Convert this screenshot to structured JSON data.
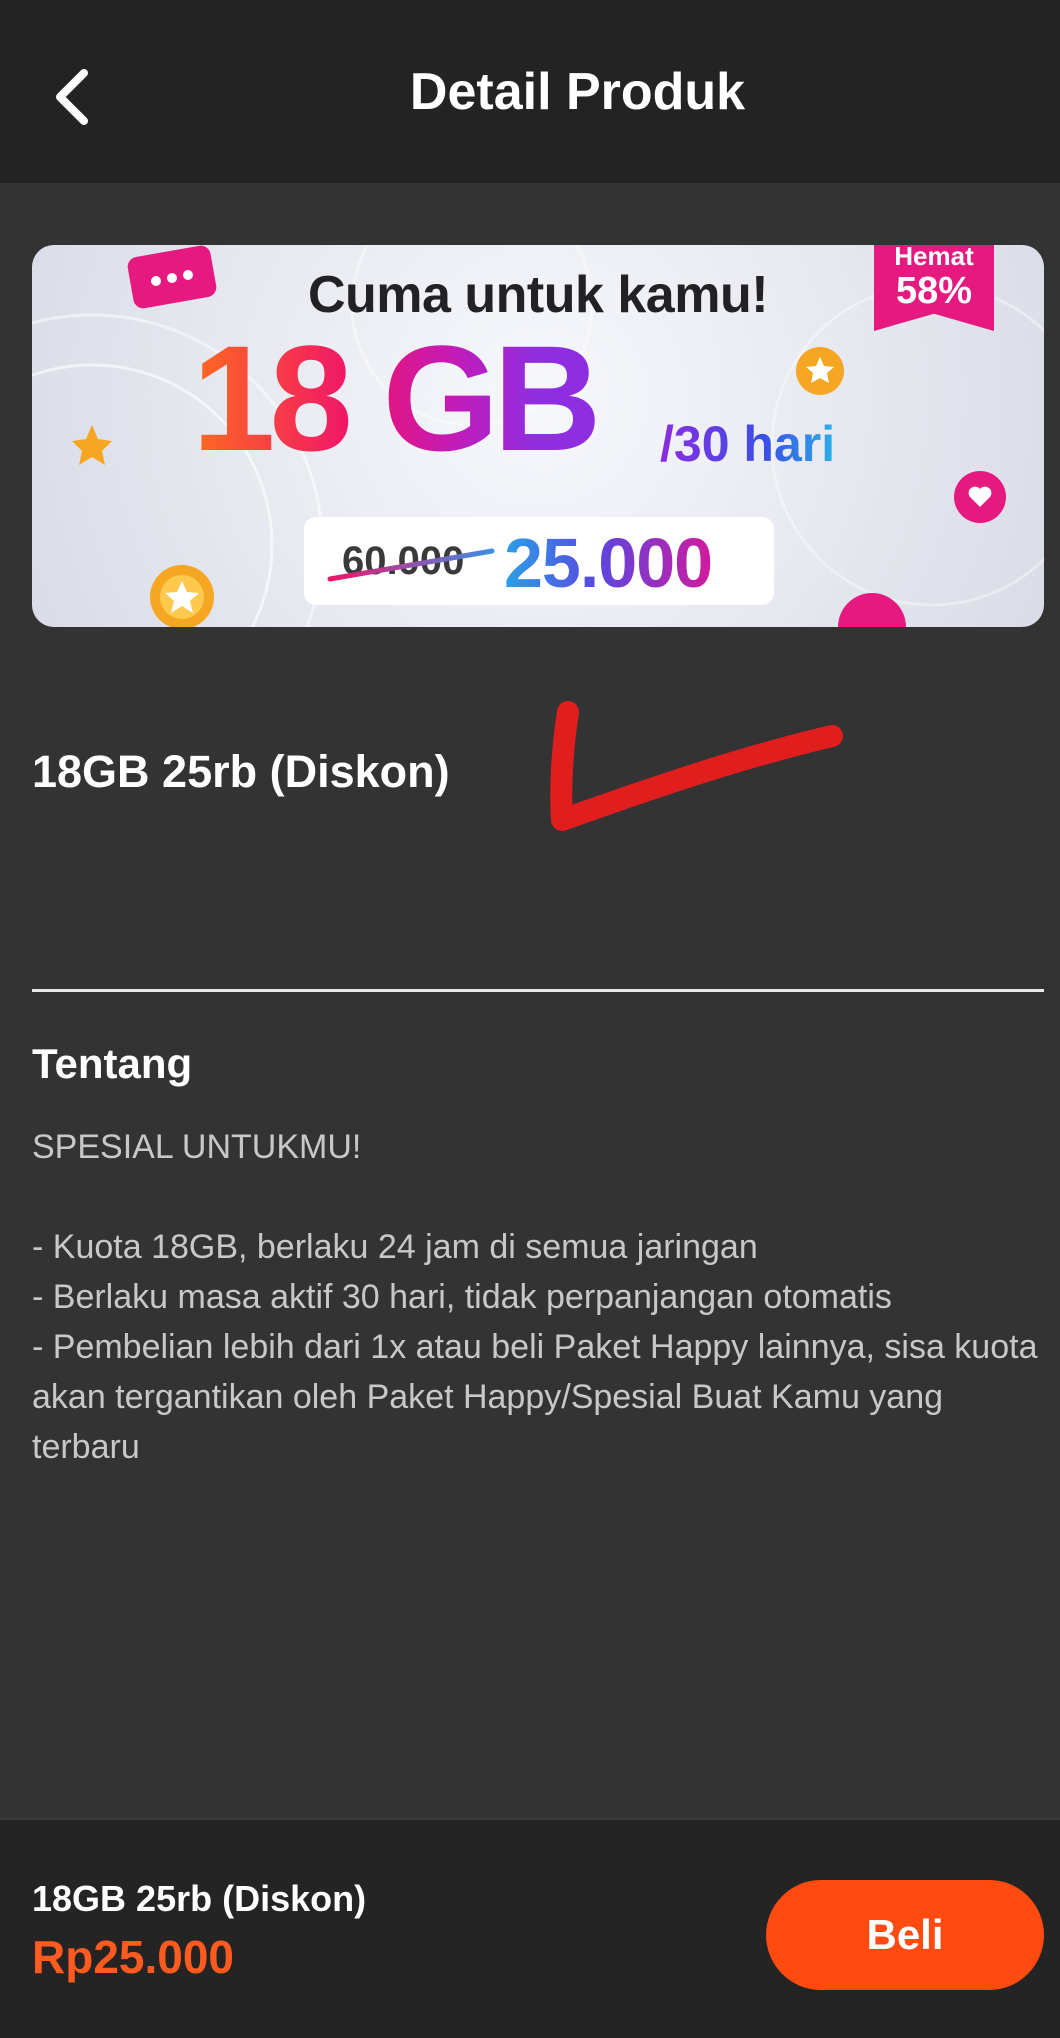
{
  "header": {
    "title": "Detail Produk",
    "back_icon": "chevron-left-icon"
  },
  "banner": {
    "headline": "Cuma untuk kamu!",
    "badge_label": "Hemat",
    "badge_value": "58%",
    "quota": "18 GB",
    "period": "/30 hari",
    "old_price": "60.000",
    "new_price": "25.000"
  },
  "product": {
    "name": "18GB 25rb (Diskon)"
  },
  "about": {
    "title": "Tentang",
    "body": "SPESIAL UNTUKMU!\n\n- Kuota 18GB, berlaku 24 jam di semua jaringan\n- Berlaku masa aktif 30 hari, tidak perpanjangan otomatis\n- Pembelian lebih dari 1x atau beli Paket Happy lainnya, sisa kuota akan tergantikan oleh Paket Happy/Spesial Buat Kamu yang terbaru"
  },
  "footer": {
    "product_name": "18GB 25rb (Diskon)",
    "price": "Rp25.000",
    "buy_label": "Beli"
  },
  "colors": {
    "background": "#333333",
    "header": "#232323",
    "accent": "#ff4a10",
    "price_text": "#ff5a1f",
    "annotation_mark": "#e01e1e"
  }
}
